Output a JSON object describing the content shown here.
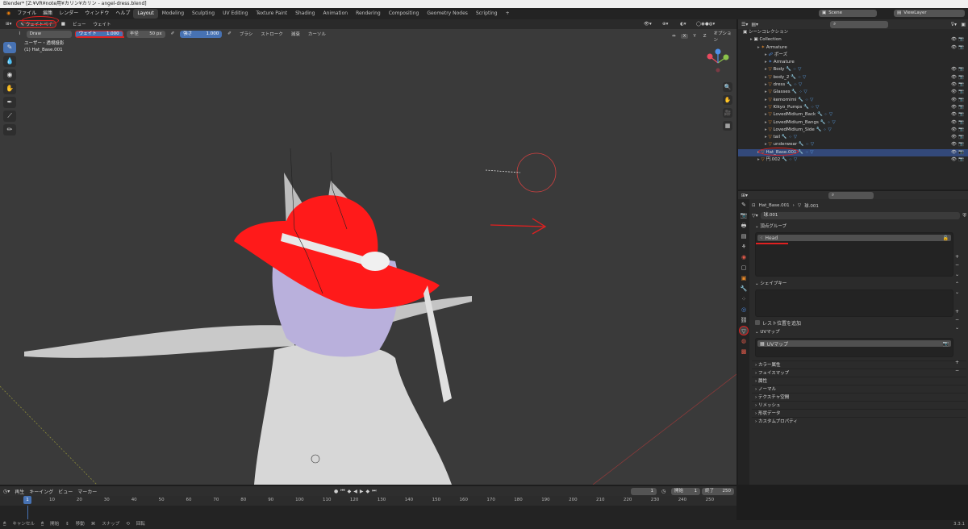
{
  "window_title": "Blender* [Z:¥VR¥note用¥カリン¥カリン - angel-dress.blend]",
  "menu": {
    "items": [
      "ファイル",
      "編集",
      "レンダー",
      "ウィンドウ",
      "ヘルプ"
    ]
  },
  "workspaces": [
    "Layout",
    "Modeling",
    "Sculpting",
    "UV Editing",
    "Texture Paint",
    "Shading",
    "Animation",
    "Rendering",
    "Compositing",
    "Geometry Nodes",
    "Scripting"
  ],
  "active_workspace": "Layout",
  "scene": "Scene",
  "view_layer": "ViewLayer",
  "viewport": {
    "mode": "ウェイトペイ",
    "menu": [
      "ビュー",
      "ウェイト"
    ],
    "brush": "Draw",
    "weight_label": "ウェイト",
    "weight_value": "1.000",
    "radius_label": "半径",
    "radius_value": "50 px",
    "strength_label": "強さ",
    "strength_value": "1.000",
    "brush_menus": [
      "ブラシ",
      "ストローク",
      "減衰",
      "カーソル"
    ],
    "options": "オプション",
    "info_line1": "ユーザー・透視投影",
    "info_line2": "(1) Hat_Base.001"
  },
  "outliner": {
    "root": "シーンコレクション",
    "rows": [
      {
        "name": "Collection",
        "indent": 1,
        "icon": "collection"
      },
      {
        "name": "Armature",
        "indent": 2,
        "icon": "armature"
      },
      {
        "name": "ポーズ",
        "indent": 3,
        "icon": "pose"
      },
      {
        "name": "Armature",
        "indent": 3,
        "icon": "armature-data"
      },
      {
        "name": "Body",
        "indent": 3,
        "icon": "mesh"
      },
      {
        "name": "body_2",
        "indent": 3,
        "icon": "mesh"
      },
      {
        "name": "dress",
        "indent": 3,
        "icon": "mesh"
      },
      {
        "name": "Glasses",
        "indent": 3,
        "icon": "mesh"
      },
      {
        "name": "kemomimi",
        "indent": 3,
        "icon": "mesh"
      },
      {
        "name": "Kikyo_Pumps",
        "indent": 3,
        "icon": "mesh"
      },
      {
        "name": "LovedMidium_Back",
        "indent": 3,
        "icon": "mesh"
      },
      {
        "name": "LovedMidium_Bangs",
        "indent": 3,
        "icon": "mesh"
      },
      {
        "name": "LovedMidium_Side",
        "indent": 3,
        "icon": "mesh"
      },
      {
        "name": "tail",
        "indent": 3,
        "icon": "mesh"
      },
      {
        "name": "underwear",
        "indent": 3,
        "icon": "mesh"
      },
      {
        "name": "Hat_Base.001",
        "indent": 2,
        "icon": "mesh",
        "selected": true
      },
      {
        "name": "円.002",
        "indent": 2,
        "icon": "mesh"
      }
    ]
  },
  "properties": {
    "breadcrumb_object": "Hat_Base.001",
    "breadcrumb_data": "球.001",
    "data_name": "球.001",
    "vertex_groups_title": "頂点グループ",
    "vertex_groups": [
      "Head"
    ],
    "shape_keys_title": "シェイプキー",
    "relative_label": "レスト位置を追加",
    "uv_maps_title": "UVマップ",
    "uv_maps": [
      "UVマップ"
    ],
    "collapsed_panels": [
      "カラー属性",
      "フェイスマップ",
      "属性",
      "ノーマル",
      "テクスチャ空間",
      "リメッシュ",
      "形状データ",
      "カスタムプロパティ"
    ]
  },
  "timeline": {
    "menus": [
      "再生",
      "キーイング",
      "ビュー",
      "マーカー"
    ],
    "current_frame": "1",
    "start_label": "開始",
    "start": "1",
    "end_label": "終了",
    "end": "250",
    "ticks": [
      "10",
      "20",
      "30",
      "40",
      "50",
      "60",
      "70",
      "80",
      "90",
      "100",
      "110",
      "120",
      "130",
      "140",
      "150",
      "160",
      "170",
      "180",
      "190",
      "200",
      "210",
      "220",
      "230",
      "240",
      "250"
    ],
    "playhead": "1"
  },
  "status": {
    "items": [
      "キャンセル",
      "開始",
      "移動",
      "スナップ",
      "回転"
    ],
    "version": "3.3.1"
  },
  "colors": {
    "accent": "#4772b3",
    "annotation": "#e02020",
    "hat": "#ff1a1a",
    "hair": "#b9b0dc"
  }
}
